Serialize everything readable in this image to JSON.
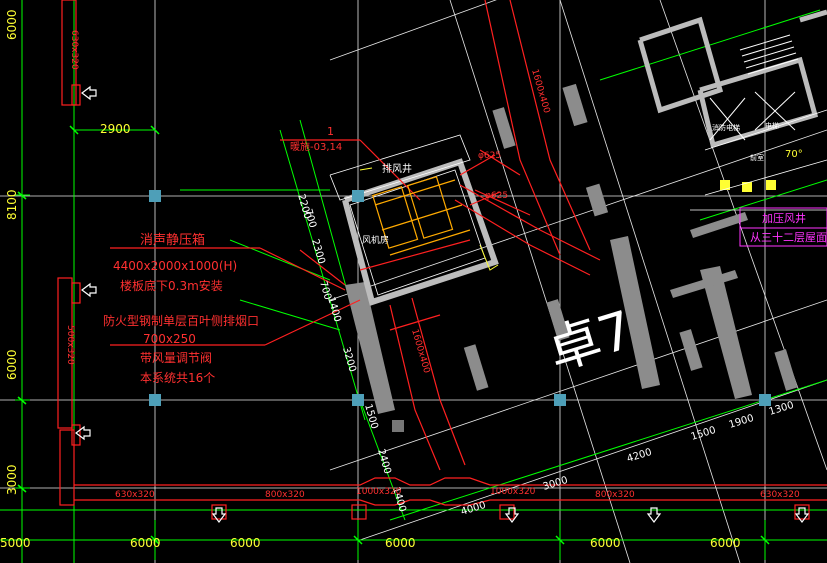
{
  "colors": {
    "background": "#000000",
    "grid_axis": "#ffffff",
    "dimension": "#00ff00",
    "duct": "#ff2020",
    "text_yellow": "#ffff33",
    "text_magenta": "#ff33ff",
    "wall": "#9a9a9a",
    "column": "#5fb0c8",
    "equipment": "#ffaa00"
  },
  "dimensions": {
    "left_top": "6000",
    "left_8100": "8100",
    "left_6000": "6000",
    "left_3000": "3000",
    "span_2900": "2900",
    "bottom_6000_a": "6000",
    "bottom_6000_b": "6000",
    "bottom_6000_c": "6000",
    "bottom_6000_d": "6000",
    "bottom_6000_e": "6000",
    "bottom_5000": "5000",
    "diag_2200": "2200",
    "diag_700_a": "700",
    "diag_2300": "2300",
    "diag_700_b": "700",
    "diag_1400": "1400",
    "diag_3200": "3200",
    "diag_1500_a": "1500",
    "diag_2400": "2400",
    "diag_1400_b": "1400",
    "diag_4000": "4000",
    "diag_3000": "3000",
    "diag_4200": "4200",
    "diag_1500_b": "1500",
    "diag_1900": "1900",
    "diag_1300": "1300",
    "angle": "70°"
  },
  "ducts": {
    "vertical_top": "630x320",
    "vertical_mid": "500x320",
    "bottom_630_left": "630x320",
    "bottom_800_a": "800x320",
    "bottom_1000": "1000x320",
    "bottom_1000_b": "1000x320",
    "bottom_800_b": "800x320",
    "bottom_630_right": "630x320",
    "diag_upper": "1600x400",
    "diag_mid": "1600x400",
    "phi_625": "φ625",
    "phi_625_b": "φ625"
  },
  "annotations": {
    "note_number": "1",
    "note_ref": "暖施-03,14",
    "exhaust_shaft": "排风井",
    "fan_room": "风机房",
    "silencer_title": "消声静压箱",
    "silencer_size": "4400x2000x1000(H)",
    "silencer_install": "楼板底下0.3m安装",
    "louver_title": "防火型钢制单层百叶侧排烟口",
    "louver_size": "700x250",
    "damper": "带风量调节阀",
    "count": "本系统共16个",
    "building_label": "卓7",
    "pressure_shaft": "加压风井",
    "from_floor": "从三十二层屋面",
    "elevator_room_1": "消防电梯",
    "elevator_room_2": "电梯",
    "lobby": "前室"
  }
}
